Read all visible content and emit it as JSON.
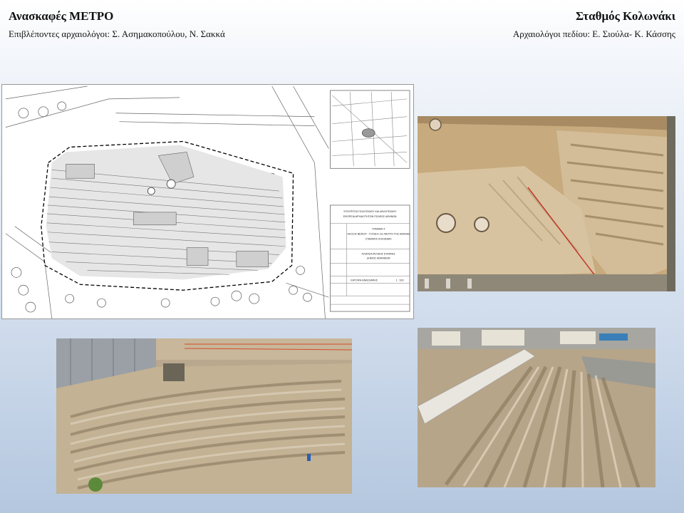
{
  "header": {
    "left_title": "Ανασκαφές ΜΕΤΡΟ",
    "left_subtitle": "Επιβλέποντες αρχαιολόγοι: Σ. Ασημακοπούλου, Ν. Σακκά",
    "right_title": "Σταθμός Κολωνάκι",
    "right_subtitle": "Αρχαιολόγοι πεδίου: Ε. Σιούλα- Κ. Κάσσης"
  },
  "plan": {
    "title_block": {
      "ministry": "ΥΠΟΥΡΓΕΙΟ ΠΟΛΙΤΙΣΜΟΥ ΚΑΙ ΑΘΛΗΤΙΣΜΟΥ",
      "ephorate": "ΕΦΟΡΕΙΑ ΑΡΧΑΙΟΤΗΤΩΝ ΠΟΛΕΩΣ ΑΘΗΝΩΝ",
      "station": "ΣΤΑΘΜΟΣ ΚΟΛΩΝΑΚΙ",
      "drawing_title": "ΓΡΑΜΜΗ 4",
      "drawing_line2": "«ΑΛΣΟΣ ΒΕΪΚΟΥ - ΓΟΥΔΗ» του ΜΕΤΡΟ ΤΗΣ ΑΘΗΝΑΣ",
      "drawing_line3": "ΣΤΑΘΜΟΣ ΚΟΛΩΝΑΚΙ",
      "area": "ΠΛΑΤΕΙΑ ΦΙΛΙΚΗΣ ΕΤΑΙΡΙΑΣ",
      "municipality": "ΔΗΜΟΣ ΑΘΗΝΑΙΩΝ",
      "plan_label": "ΚΑΤΟΨΗ ΑΝΑΣΚΑΦΗΣ",
      "scale": "1 : 100"
    }
  }
}
